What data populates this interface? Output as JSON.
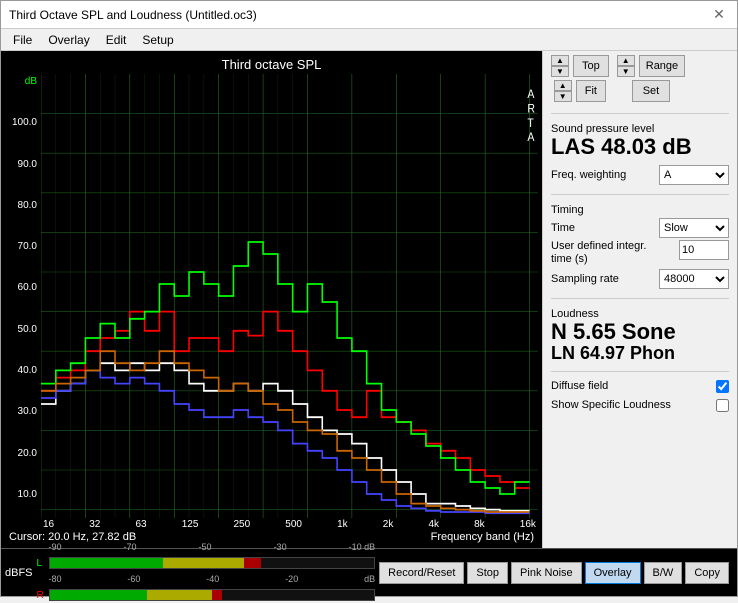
{
  "window": {
    "title": "Third Octave SPL and Loudness (Untitled.oc3)"
  },
  "menu": {
    "items": [
      "File",
      "Overlay",
      "Edit",
      "Setup"
    ]
  },
  "chart": {
    "title": "Third octave SPL",
    "y_label": "dB",
    "arta_label": "A\nR\nT\nA",
    "y_ticks": [
      "100.0",
      "90.0",
      "80.0",
      "70.0",
      "60.0",
      "50.0",
      "40.0",
      "30.0",
      "20.0",
      "10.0"
    ],
    "x_ticks": [
      "16",
      "32",
      "63",
      "125",
      "250",
      "500",
      "1k",
      "2k",
      "4k",
      "8k",
      "16k"
    ],
    "cursor_text": "Cursor:  20.0 Hz, 27.82 dB",
    "freq_label": "Frequency band (Hz)"
  },
  "top_controls": {
    "top_label": "Top",
    "fit_label": "Fit",
    "range_label": "Range",
    "set_label": "Set"
  },
  "spl": {
    "section_label": "Sound pressure level",
    "value": "LAS 48.03 dB",
    "freq_weighting_label": "Freq. weighting",
    "freq_weighting_value": "A"
  },
  "timing": {
    "section_label": "Timing",
    "time_label": "Time",
    "time_value": "Slow",
    "user_integr_label": "User defined integr. time (s)",
    "user_integr_value": "10",
    "sampling_label": "Sampling rate",
    "sampling_value": "48000"
  },
  "loudness": {
    "section_label": "Loudness",
    "n_value": "N 5.65 Sone",
    "ln_value": "LN 64.97 Phon",
    "diffuse_field_label": "Diffuse field",
    "diffuse_field_checked": true,
    "show_specific_label": "Show Specific Loudness",
    "show_specific_checked": false
  },
  "bottom": {
    "dbfs_label": "dBFS",
    "meter_l_label": "L",
    "meter_r_label": "R",
    "ticks_top": [
      "-90",
      "-70",
      "-50",
      "-30",
      "-10 dB"
    ],
    "ticks_bottom": [
      "-80",
      "-60",
      "-40",
      "-20",
      "dB"
    ],
    "buttons": [
      "Record/Reset",
      "Stop",
      "Pink Noise",
      "Overlay",
      "B/W",
      "Copy"
    ]
  }
}
